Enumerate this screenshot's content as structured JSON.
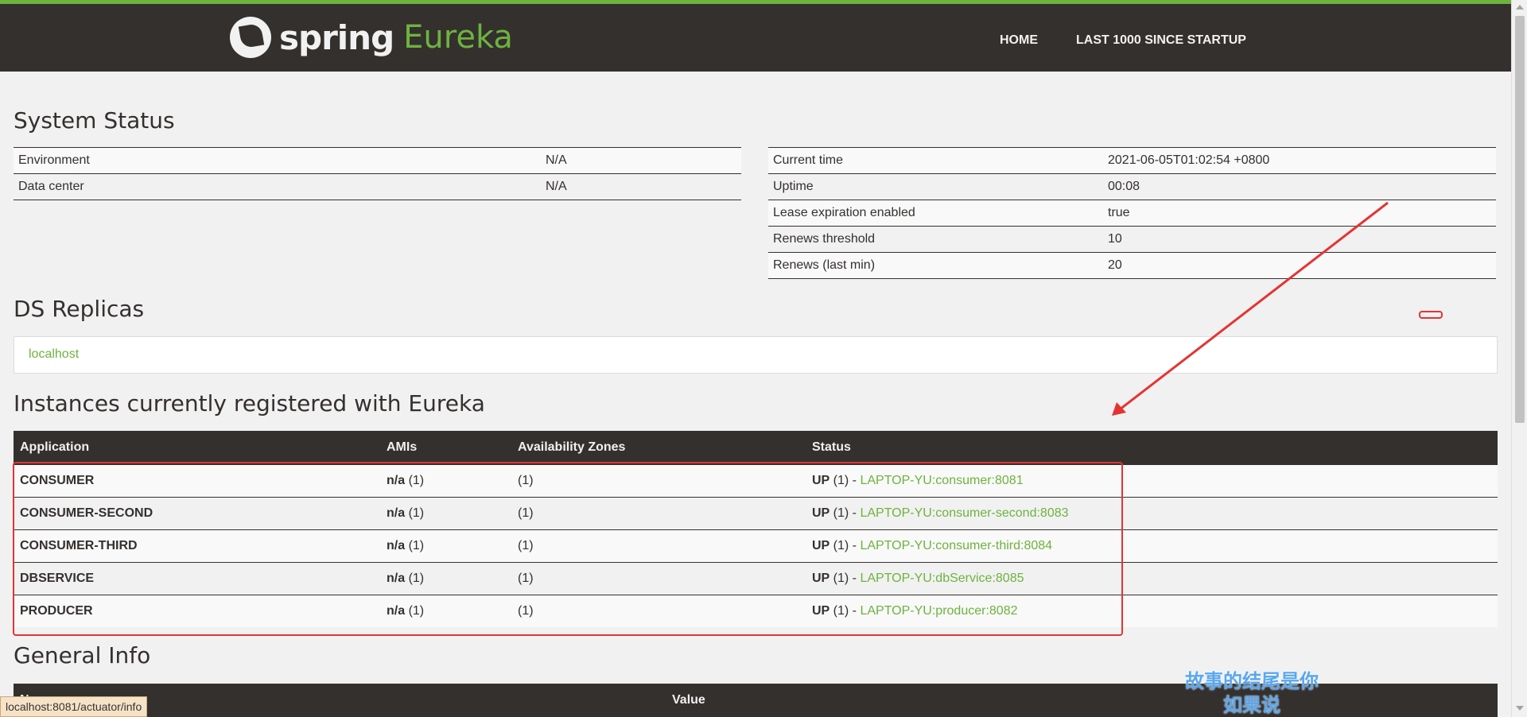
{
  "header": {
    "brand_spring": "spring",
    "brand_eureka": "Eureka",
    "nav_home": "HOME",
    "nav_last": "LAST 1000 SINCE STARTUP"
  },
  "system_status": {
    "title": "System Status",
    "left": [
      {
        "label": "Environment",
        "value": "N/A"
      },
      {
        "label": "Data center",
        "value": "N/A"
      }
    ],
    "right": [
      {
        "label": "Current time",
        "value": "2021-06-05T01:02:54 +0800"
      },
      {
        "label": "Uptime",
        "value": "00:08"
      },
      {
        "label": "Lease expiration enabled",
        "value": "true"
      },
      {
        "label": "Renews threshold",
        "value": "10"
      },
      {
        "label": "Renews (last min)",
        "value": "20"
      }
    ]
  },
  "replicas": {
    "title": "DS Replicas",
    "items": [
      "localhost"
    ]
  },
  "instances": {
    "title": "Instances currently registered with Eureka",
    "columns": [
      "Application",
      "AMIs",
      "Availability Zones",
      "Status"
    ],
    "rows": [
      {
        "app": "CONSUMER",
        "ami": "n/a",
        "ami_count": " (1)",
        "zones": "(1)",
        "status": "UP",
        "status_count": " (1) - ",
        "link": "LAPTOP-YU:consumer:8081"
      },
      {
        "app": "CONSUMER-SECOND",
        "ami": "n/a",
        "ami_count": " (1)",
        "zones": "(1)",
        "status": "UP",
        "status_count": " (1) - ",
        "link": "LAPTOP-YU:consumer-second:8083"
      },
      {
        "app": "CONSUMER-THIRD",
        "ami": "n/a",
        "ami_count": " (1)",
        "zones": "(1)",
        "status": "UP",
        "status_count": " (1) - ",
        "link": "LAPTOP-YU:consumer-third:8084"
      },
      {
        "app": "DBSERVICE",
        "ami": "n/a",
        "ami_count": " (1)",
        "zones": "(1)",
        "status": "UP",
        "status_count": " (1) - ",
        "link": "LAPTOP-YU:dbService:8085"
      },
      {
        "app": "PRODUCER",
        "ami": "n/a",
        "ami_count": " (1)",
        "zones": "(1)",
        "status": "UP",
        "status_count": " (1) - ",
        "link": "LAPTOP-YU:producer:8082"
      }
    ]
  },
  "general_info": {
    "title": "General Info",
    "col_name": "Name",
    "col_value": "Value"
  },
  "status_bar_url": "localhost:8081/actuator/info",
  "overlay_text": [
    "故事的结尾是你",
    "如果说"
  ],
  "colors": {
    "accent": "#6db33f",
    "dark": "#34302d",
    "annotation": "#e53333"
  }
}
